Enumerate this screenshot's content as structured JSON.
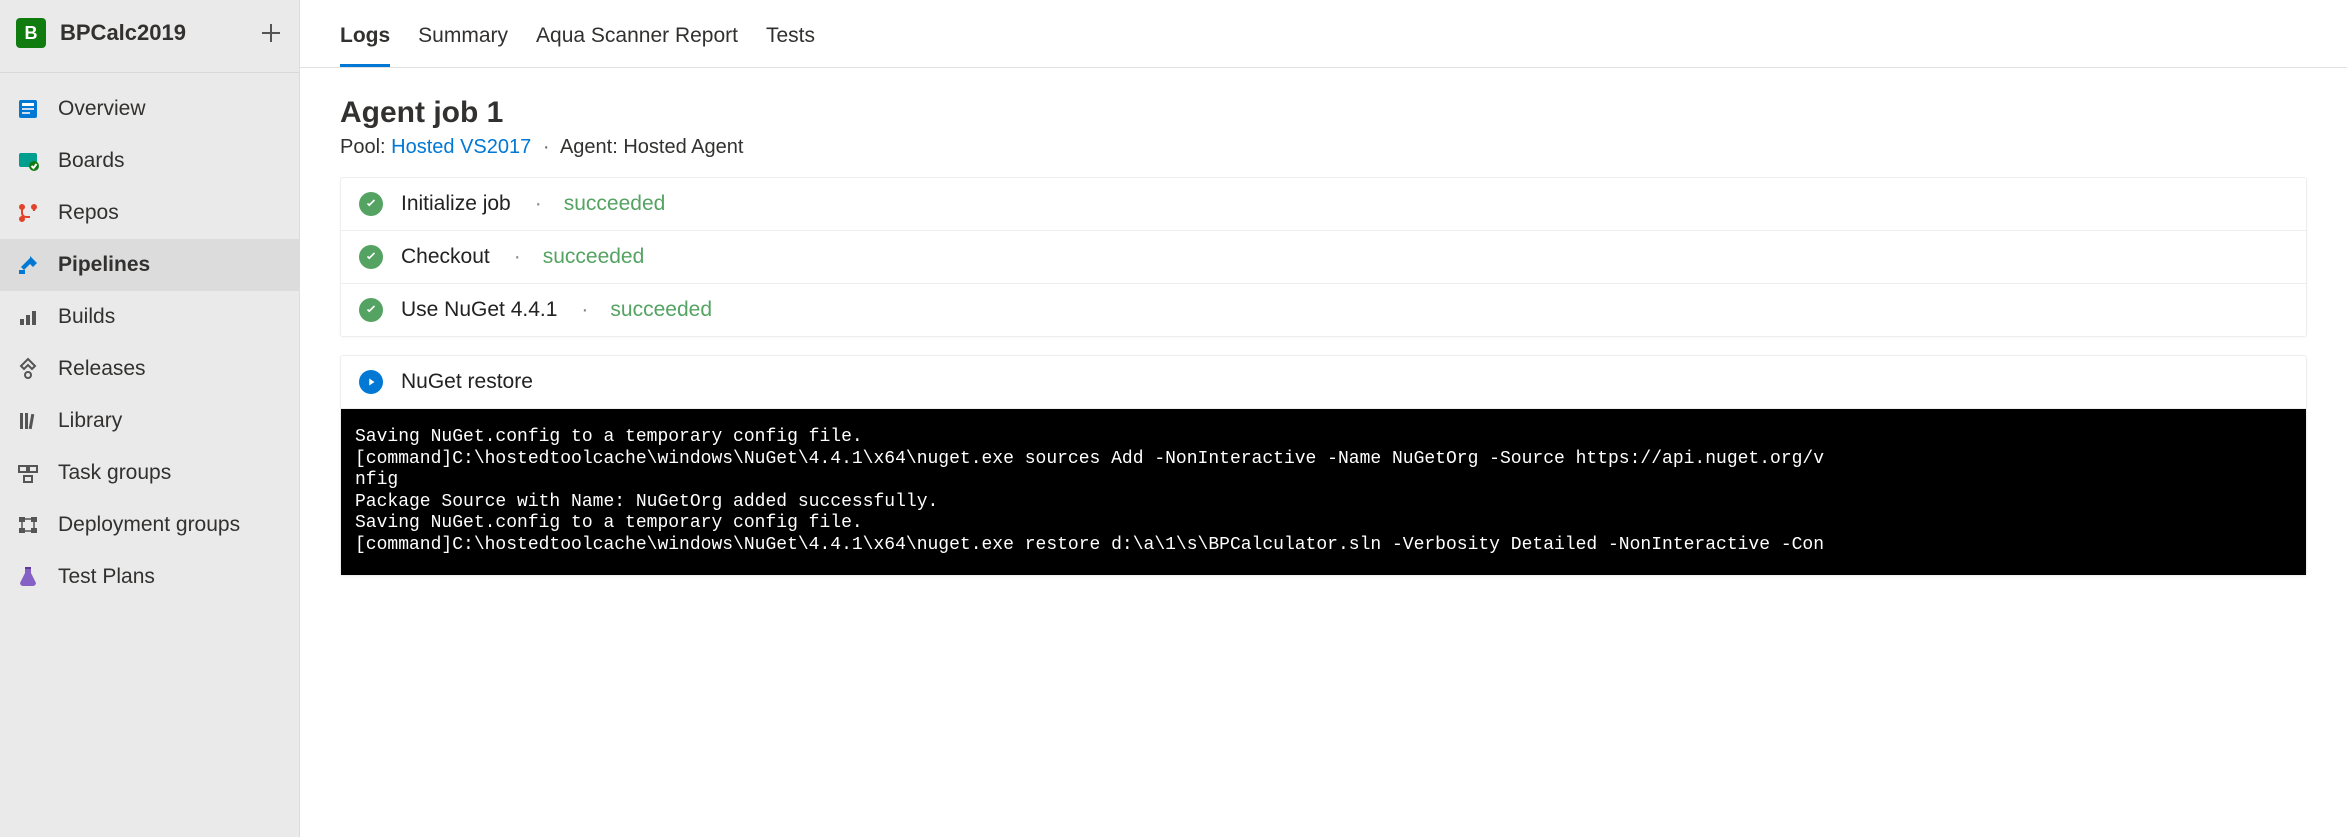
{
  "project": {
    "badge": "B",
    "title": "BPCalc2019"
  },
  "sidebar": {
    "items": [
      {
        "label": "Overview",
        "icon": "overview"
      },
      {
        "label": "Boards",
        "icon": "boards"
      },
      {
        "label": "Repos",
        "icon": "repos"
      },
      {
        "label": "Pipelines",
        "icon": "pipelines",
        "active": true
      },
      {
        "label": "Builds",
        "icon": "builds",
        "sub": true
      },
      {
        "label": "Releases",
        "icon": "releases",
        "sub": true
      },
      {
        "label": "Library",
        "icon": "library",
        "sub": true
      },
      {
        "label": "Task groups",
        "icon": "taskgroups",
        "sub": true
      },
      {
        "label": "Deployment groups",
        "icon": "deploymentgroups",
        "sub": true
      },
      {
        "label": "Test Plans",
        "icon": "testplans"
      }
    ]
  },
  "tabs": [
    {
      "label": "Logs",
      "active": true
    },
    {
      "label": "Summary"
    },
    {
      "label": "Aqua Scanner Report"
    },
    {
      "label": "Tests"
    }
  ],
  "job": {
    "title": "Agent job 1",
    "pool_label": "Pool:",
    "pool_link": "Hosted VS2017",
    "agent_text": "Agent: Hosted Agent"
  },
  "steps_done": [
    {
      "name": "Initialize job",
      "status": "succeeded"
    },
    {
      "name": "Checkout",
      "status": "succeeded"
    },
    {
      "name": "Use NuGet 4.4.1",
      "status": "succeeded"
    }
  ],
  "step_running": {
    "name": "NuGet restore"
  },
  "console_lines": [
    "Saving NuGet.config to a temporary config file.",
    "[command]C:\\hostedtoolcache\\windows\\NuGet\\4.4.1\\x64\\nuget.exe sources Add -NonInteractive -Name NuGetOrg -Source https://api.nuget.org/v",
    "nfig",
    "Package Source with Name: NuGetOrg added successfully.",
    "Saving NuGet.config to a temporary config file.",
    "[command]C:\\hostedtoolcache\\windows\\NuGet\\4.4.1\\x64\\nuget.exe restore d:\\a\\1\\s\\BPCalculator.sln -Verbosity Detailed -NonInteractive -Con"
  ]
}
